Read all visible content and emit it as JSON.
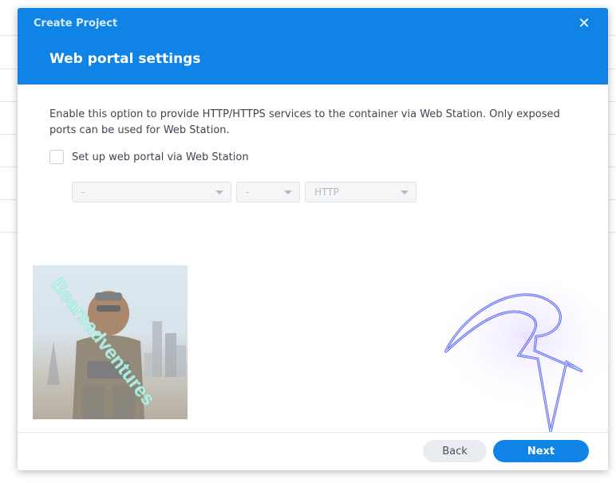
{
  "dialog": {
    "app_title": "Create Project",
    "close_icon": "close-icon",
    "step_title": "Web portal settings"
  },
  "body": {
    "description": "Enable this option to provide HTTP/HTTPS services to the container via Web Station. Only exposed ports can be used for Web Station.",
    "checkbox_label": "Set up web portal via Web Station",
    "checkbox_checked": false,
    "host_select_value": "-",
    "port_select_value": "-",
    "protocol_select_value": "HTTP"
  },
  "overlay": {
    "watermark_text": "Bearsadventures"
  },
  "footer": {
    "back_label": "Back",
    "next_label": "Next"
  },
  "colors": {
    "accent": "#1083e6",
    "button_secondary": "#e9edf1"
  }
}
